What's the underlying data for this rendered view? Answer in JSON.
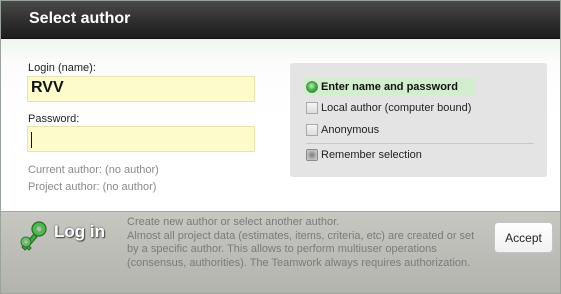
{
  "window": {
    "title": "Select author"
  },
  "form": {
    "login_label": "Login (name):",
    "login_value": "RVV",
    "password_label": "Password:",
    "password_value": "",
    "current_author": "Current author: (no author)",
    "project_author": "Project author: (no author)"
  },
  "options": {
    "items": [
      {
        "label": "Enter name and password",
        "type": "radio",
        "selected": true
      },
      {
        "label": "Local author (computer bound)",
        "type": "checkbox",
        "selected": false
      },
      {
        "label": "Anonymous",
        "type": "checkbox",
        "selected": false
      }
    ],
    "remember_label": "Remember selection",
    "remember_checked": true
  },
  "footer": {
    "login_label": "Log in",
    "description_lines": [
      "Create new author or select another author.",
      "Almost all project data (estimates, items, criteria, etc) are created or set",
      "by a specific author. This allows to perform multiuser operations",
      "(consensus, authorities). The Teamwork always requires authorization."
    ],
    "accept_label": "Accept",
    "icon": "key-icon"
  },
  "colors": {
    "title_bar": "#2e2e2e",
    "input_background": "#fdfbcc",
    "selected_option": "#d3eecf",
    "radio_green": "#3cac3c",
    "footer": "#bdbdb8"
  }
}
